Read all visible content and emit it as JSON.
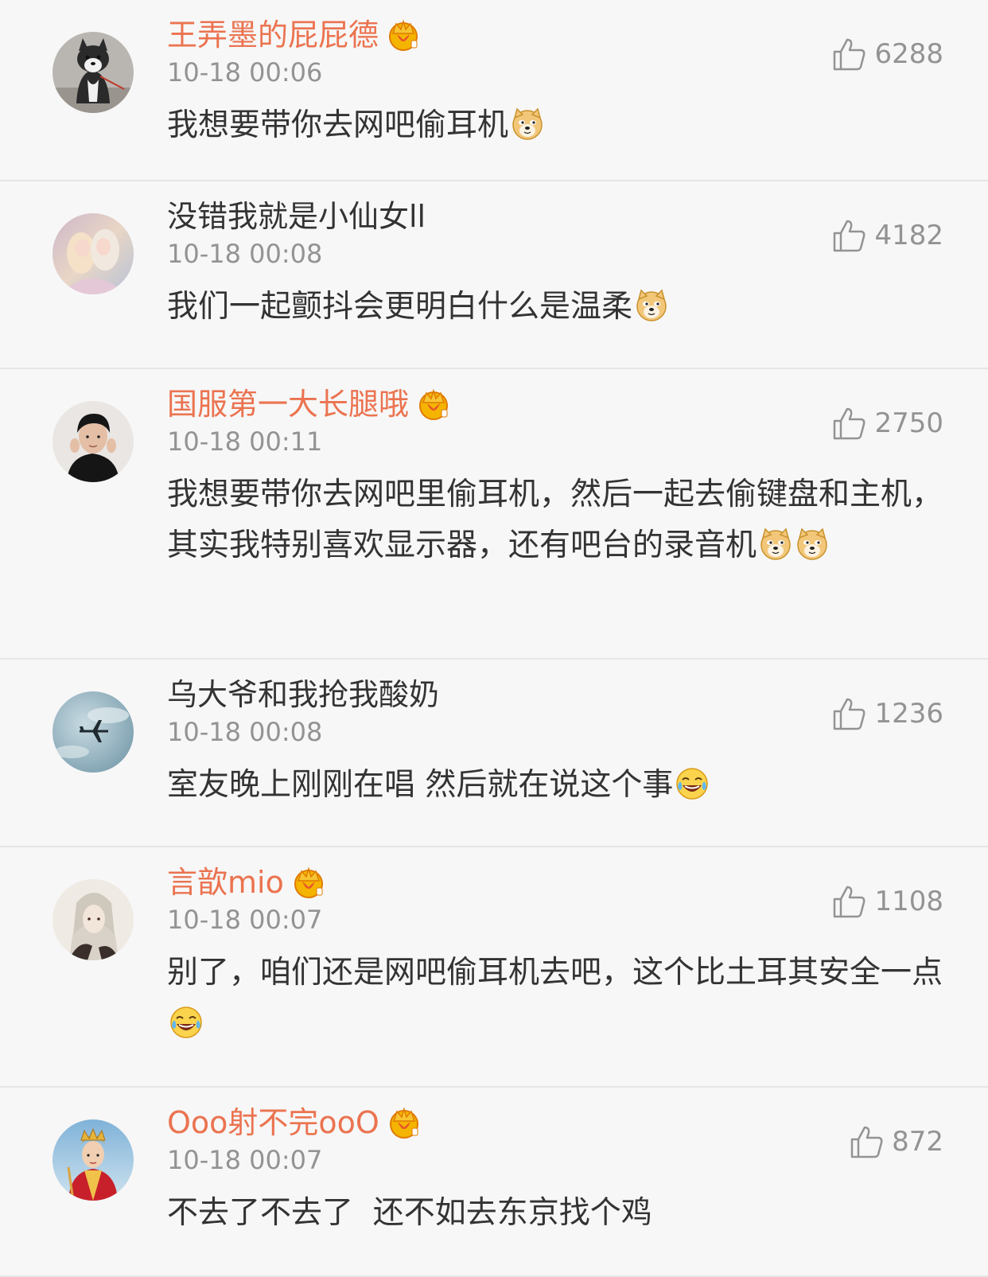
{
  "comments": [
    {
      "username": "王弄墨的屁屁德",
      "vip": true,
      "time": "10-18 00:06",
      "likes": "6288",
      "text": "我想要带你去网吧偷耳机",
      "emoji": "doge-emoji",
      "avatar": "husky-dog-avatar"
    },
    {
      "username": "没错我就是小仙女ll",
      "vip": false,
      "time": "10-18 00:08",
      "likes": "4182",
      "text": "我们一起颤抖会更明白什么是温柔",
      "emoji": "doge-emoji",
      "avatar": "pastel-girls-avatar"
    },
    {
      "username": "国服第一大长腿哦",
      "vip": true,
      "time": "10-18 00:11",
      "likes": "2750",
      "text": "我想要带你去网吧里偷耳机，然后一起去偷键盘和主机，其实我特别喜欢显示器，还有吧台的录音机",
      "emoji": "doge-emoji",
      "emoji2": "doge-emoji",
      "avatar": "boy-portrait-avatar"
    },
    {
      "username": "乌大爷和我抢我酸奶",
      "vip": false,
      "time": "10-18 00:08",
      "likes": "1236",
      "text": "室友晚上刚刚在唱 然后就在说这个事",
      "emoji": "laugh-cry-emoji",
      "avatar": "airplane-sky-avatar"
    },
    {
      "username": "言歆mio",
      "vip": true,
      "time": "10-18 00:07",
      "likes": "1108",
      "text": "别了，咱们还是网吧偷耳机去吧，这个比土耳其安全一点",
      "emoji": "laugh-cry-emoji",
      "avatar": "anime-character-avatar"
    },
    {
      "username": "Ooo射不完ooO",
      "vip": true,
      "time": "10-18 00:07",
      "likes": "872",
      "text": "不去了不去了  还不如去东京找个鸡",
      "emoji": "",
      "avatar": "monk-costume-avatar"
    }
  ],
  "colors": {
    "vip_name": "#eb7350",
    "normal_name": "#333333",
    "meta": "#939393",
    "divider": "#e6e6e6",
    "background": "#f7f7f7"
  }
}
